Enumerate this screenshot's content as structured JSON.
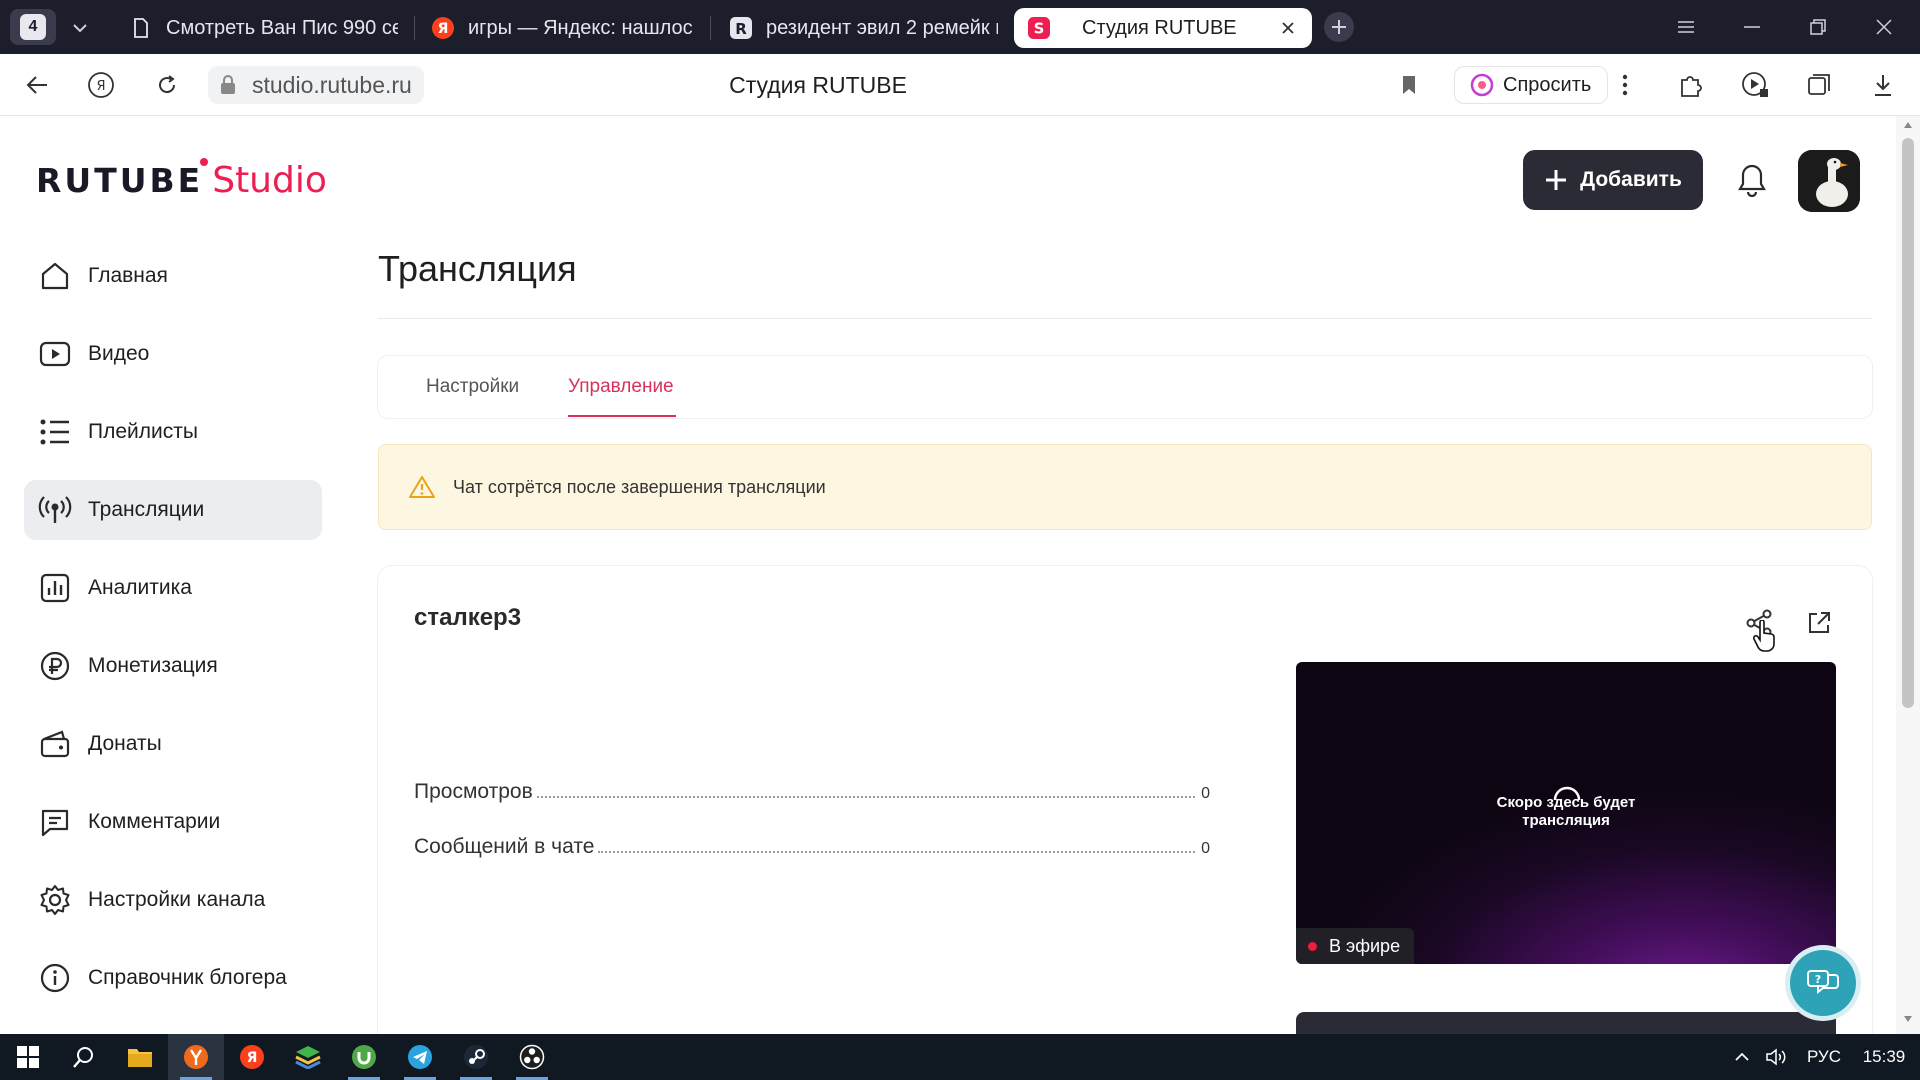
{
  "browser": {
    "tab_count": "4",
    "tabs": [
      {
        "label": "Смотреть Ван Пис 990 се"
      },
      {
        "label": "игры — Яндекс: нашлось"
      },
      {
        "label": "резидент эвил 2 ремейк г"
      },
      {
        "label": "Студия RUTUBE"
      }
    ],
    "url": "studio.rutube.ru",
    "page_title": "Студия RUTUBE",
    "ask_label": "Спросить"
  },
  "header": {
    "logo_brand": "RUTUBE",
    "logo_product": "Studio",
    "add_label": "Добавить"
  },
  "sidebar": {
    "items": [
      {
        "label": "Главная",
        "icon": "home-icon"
      },
      {
        "label": "Видео",
        "icon": "video-icon"
      },
      {
        "label": "Плейлисты",
        "icon": "playlist-icon"
      },
      {
        "label": "Трансляции",
        "icon": "broadcast-icon",
        "active": true
      },
      {
        "label": "Аналитика",
        "icon": "analytics-icon"
      },
      {
        "label": "Монетизация",
        "icon": "ruble-icon"
      },
      {
        "label": "Донаты",
        "icon": "wallet-icon"
      },
      {
        "label": "Комментарии",
        "icon": "comment-icon"
      },
      {
        "label": "Настройки канала",
        "icon": "gear-icon"
      },
      {
        "label": "Справочник блогера",
        "icon": "info-icon"
      }
    ]
  },
  "main": {
    "title": "Трансляция",
    "tabs": [
      {
        "label": "Настройки"
      },
      {
        "label": "Управление",
        "active": true
      }
    ],
    "warning": "Чат сотрётся после завершения трансляции",
    "stream": {
      "name": "сталкер3",
      "stats": [
        {
          "label": "Просмотров",
          "value": "0"
        },
        {
          "label": "Сообщений в чате",
          "value": "0"
        }
      ],
      "preview_line1": "Скоро здесь будет",
      "preview_line2": "трансляция",
      "live_label": "В эфире"
    }
  },
  "taskbar": {
    "language": "РУС",
    "time": "15:39"
  },
  "colors": {
    "accent": "#ec1e52",
    "active_tab": "#d8325a",
    "warning_bg": "#fdf7e2",
    "dark_button": "#2a2b34",
    "help_fab": "#2ea3b8"
  }
}
